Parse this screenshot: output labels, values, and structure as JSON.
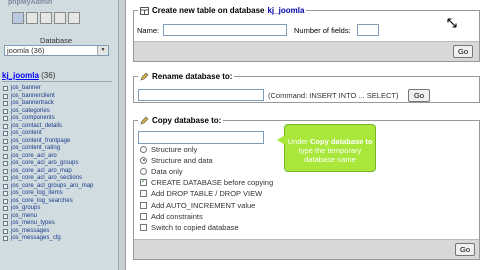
{
  "nav": {
    "logo": "phpMyAdmin",
    "database_label": "Database",
    "database_select": "joomla (36)",
    "db_name": "kj_joomla",
    "db_count": "(36)",
    "tables": [
      "jos_banner",
      "jos_bannerclient",
      "jos_bannertrack",
      "jos_categories",
      "jos_components",
      "jos_contact_details",
      "jos_content",
      "jos_content_frontpage",
      "jos_content_rating",
      "jos_core_acl_aro",
      "jos_core_acl_aro_groups",
      "jos_core_acl_aro_map",
      "jos_core_acl_aro_sections",
      "jos_core_acl_groups_aro_map",
      "jos_core_log_items",
      "jos_core_log_searches",
      "jos_groups",
      "jos_menu",
      "jos_menu_types",
      "jos_messages",
      "jos_messages_cfg"
    ]
  },
  "create_table": {
    "legend": "Create new table on database",
    "db_name": "kj_joomla",
    "name_label": "Name:",
    "fields_label": "Number of fields:",
    "go_label": "Go"
  },
  "rename": {
    "legend": "Rename database to:",
    "hint": "(Command: INSERT INTO ... SELECT)",
    "go_label": "Go"
  },
  "copy": {
    "legend": "Copy database to:",
    "options": [
      "Structure only",
      "Structure and data",
      "Data only"
    ],
    "checks": [
      "CREATE DATABASE before copying",
      "Add DROP TABLE / DROP VIEW",
      "Add AUTO_INCREMENT value",
      "Add constraints",
      "Switch to copied database"
    ],
    "go_label": "Go"
  },
  "tooltip": {
    "line1": "Under ",
    "bold": "Copy database to",
    "line2": " type the temporary database name"
  }
}
